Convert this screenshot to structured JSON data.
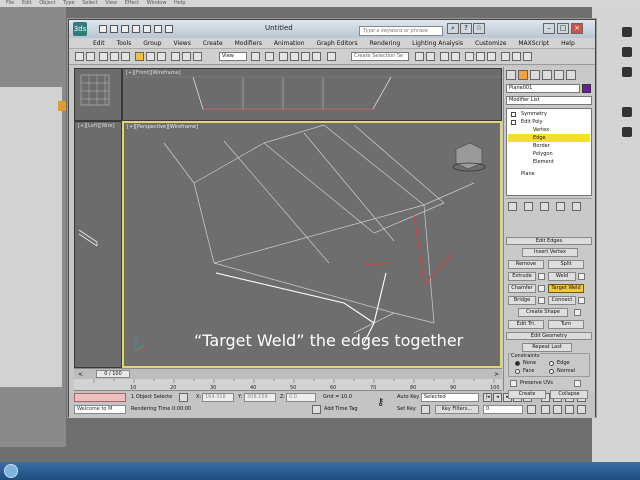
{
  "background_menu": [
    "File",
    "Edit",
    "Object",
    "Type",
    "Select",
    "View",
    "Effect",
    "Window",
    "Help"
  ],
  "app": {
    "logo": "3ds",
    "title": "Untitled",
    "search_placeholder": "Type a keyword or phrase"
  },
  "menu": [
    "Edit",
    "Tools",
    "Group",
    "Views",
    "Create",
    "Modifiers",
    "Animation",
    "Graph Editors",
    "Rendering",
    "Lighting Analysis",
    "Customize",
    "MAXScript",
    "Help"
  ],
  "toolbar": {
    "view_select": "View",
    "selection_set": "Create Selection Se"
  },
  "viewports": {
    "top_label": "[+][Top][Wireframe]",
    "front_label": "[+][Front][Wireframe]",
    "left_label": "[+][Left][Wire]",
    "persp_label": "[+][Perspective][Wireframe]"
  },
  "caption": "“Target Weld” the edges together",
  "timeline": {
    "position": "0 / 100",
    "ticks": [
      "10",
      "20",
      "30",
      "40",
      "50",
      "60",
      "70",
      "80",
      "90",
      "100"
    ]
  },
  "status": {
    "selection": "1 Object Selecte",
    "x_label": "X:",
    "x_value": "164.318",
    "y_label": "Y:",
    "y_value": "308.159",
    "z_label": "Z:",
    "z_value": "0.0",
    "grid": "Grid = 10.0",
    "auto_key": "Auto Key",
    "set_key": "Set Key",
    "key_mode": "Selected",
    "key_filters": "Key Filters...",
    "frame": "0",
    "add_time_tag": "Add Time Tag",
    "rendering_time": "Rendering Time  0:00:00",
    "maxscript": "Welcome to M"
  },
  "command_panel": {
    "object_name": "Plane001",
    "object_color": "#6a1aa0",
    "modifier_list": "Modifier List",
    "stack": [
      "Symmetry",
      "Edit Poly",
      "Vertex",
      "Edge",
      "Border",
      "Polygon",
      "Element",
      "Plane"
    ],
    "selected_stack_item": "Edge",
    "edit_edges_title": "Edit Edges",
    "insert_vertex": "Insert Vertex",
    "remove": "Remove",
    "split": "Split",
    "extrude": "Extrude",
    "weld": "Weld",
    "chamfer": "Chamfer",
    "target_weld": "Target Weld",
    "bridge": "Bridge",
    "connect": "Connect",
    "create_shape": "Create Shape",
    "edit_tri": "Edit Tri.",
    "turn": "Turn",
    "edit_geometry_title": "Edit Geometry",
    "repeat_last": "Repeat Last",
    "constraints": "Constraints",
    "none": "None",
    "edge": "Edge",
    "face": "Face",
    "normal": "Normal",
    "preserve_uvs": "Preserve UVs",
    "create": "Create",
    "collapse": "Collapse"
  },
  "colors": {
    "selection_highlight": "#f3e02a",
    "active_viewport_border": "#e3d66b",
    "taskbar": "#2a5a8c"
  }
}
